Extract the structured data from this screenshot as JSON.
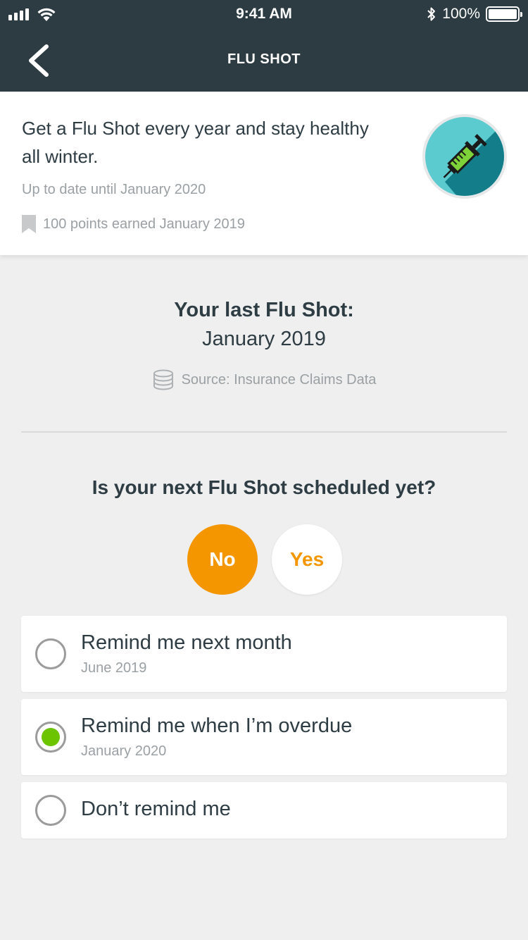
{
  "status_bar": {
    "time": "9:41 AM",
    "battery": "100%"
  },
  "nav": {
    "title": "FLU SHOT"
  },
  "summary": {
    "description": "Get a Flu Shot every year and stay healthy all winter.",
    "up_to_date": "Up to date until January 2020",
    "points": "100 points earned January 2019"
  },
  "last_shot": {
    "label": "Your last Flu Shot:",
    "date": "January 2019",
    "source": "Source: Insurance Claims Data"
  },
  "scheduled": {
    "question": "Is your next Flu Shot scheduled yet?",
    "no_label": "No",
    "yes_label": "Yes"
  },
  "reminders": [
    {
      "title": "Remind me next month",
      "subtitle": "June 2019",
      "selected": false
    },
    {
      "title": "Remind me when I’m overdue",
      "subtitle": "January 2020",
      "selected": true
    },
    {
      "title": "Don’t remind me",
      "subtitle": "",
      "selected": false
    }
  ],
  "colors": {
    "header": "#2c3c42",
    "accent": "#f39600",
    "selected": "#6cc400",
    "background": "#efefef"
  }
}
